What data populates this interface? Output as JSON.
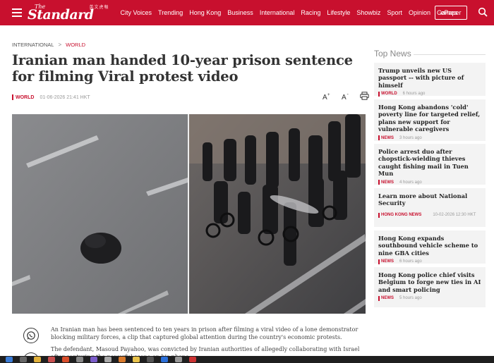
{
  "header": {
    "logo_the": "The",
    "logo_name": "Standard",
    "logo_cn": "英文虎報",
    "nav": [
      "City Voices",
      "Trending",
      "Hong Kong",
      "Business",
      "International",
      "Racing",
      "Lifestyle",
      "Showbiz",
      "Sport",
      "Opinion",
      "Games"
    ],
    "epaper": "ePaper",
    "accent": "#c8102e"
  },
  "article": {
    "breadcrumb": {
      "parent": "INTERNATIONAL",
      "current": "WORLD"
    },
    "headline": "Iranian man handed 10-year prison sentence for filming Viral protest video",
    "category": "WORLD",
    "date": "01-06-2026 21:41 HKT",
    "tools": {
      "font_up": "A⁺",
      "font_down": "A⁻",
      "print": "print-icon"
    },
    "paragraph1": "An Iranian man has been sentenced to ten years in prison after filming a viral video of a lone demonstrator blocking military forces, a clip that captured global attention during the country's economic protests.",
    "paragraph2": "The defendant, Masoud Payahoo, was convicted by Iranian authorities of allegedly collaborating with Israel after capturing the powerful scene on his phone."
  },
  "sidebar": {
    "title": "Top News",
    "items": [
      {
        "title": "Trump unveils new US passport -- with picture of himself",
        "category": "WORLD",
        "time": "6 hours ago"
      },
      {
        "title": "Hong Kong abandons 'cold' poverty line for targeted relief, plans new support for vulnerable caregivers",
        "category": "NEWS",
        "time": "3 hours ago"
      },
      {
        "title": "Police arrest duo after chopstick-wielding thieves caught fishing mail in Tuen Mun",
        "category": "NEWS",
        "time": "4 hours ago"
      },
      {
        "title": "Learn more about National Security",
        "category": "HONG KONG NEWS",
        "time": "10-02-2026 12:30 HKT"
      },
      {
        "title": "Hong Kong expands southbound vehicle scheme to nine GBA cities",
        "category": "NEWS",
        "time": "6 hours ago"
      },
      {
        "title": "Hong Kong police chief visits Belgium to forge new ties in AI and smart policing",
        "category": "NEWS",
        "time": "5 hours ago"
      }
    ]
  }
}
